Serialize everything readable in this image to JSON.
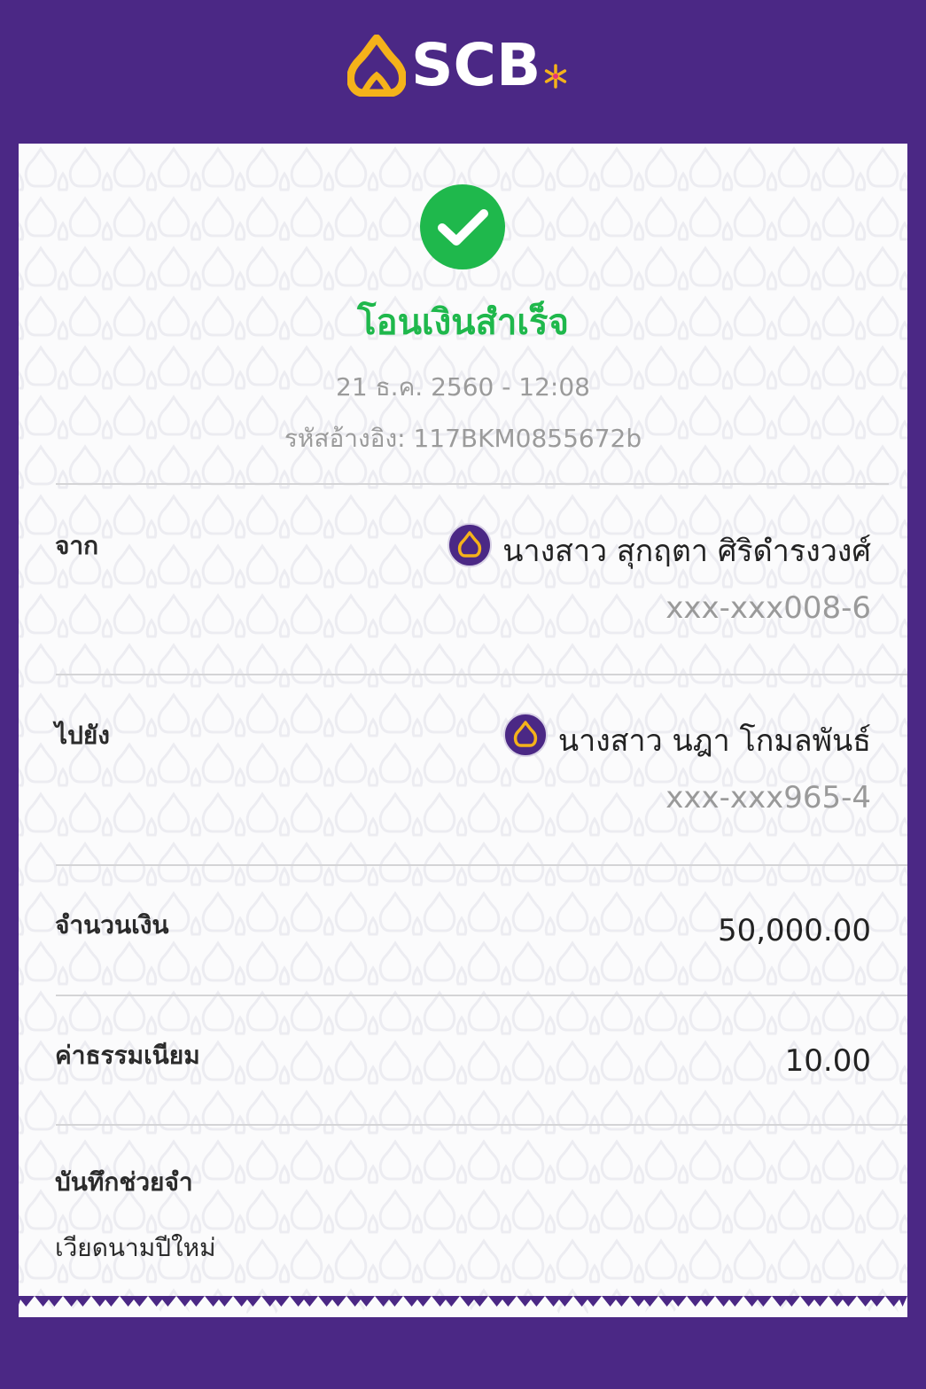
{
  "header": {
    "brand": "SCB",
    "colors": {
      "background": "#4b2885",
      "logo_gold": "#f5b21a",
      "star": "#f5b21a"
    }
  },
  "status": {
    "icon": "check-circle-icon",
    "title": "โอนเงินสำเร็จ",
    "datetime": "21 ธ.ค. 2560 - 12:08",
    "ref_label": "รหัสอ้างอิง:",
    "ref_value": "117BKM0855672b",
    "color": "#1fb84c"
  },
  "from": {
    "label": "จาก",
    "name": "นางสาว สุกฤตา ศิริดำรงวงศ์",
    "account": "xxx-xxx008-6",
    "bank_icon": "scb-bank-icon"
  },
  "to": {
    "label": "ไปยัง",
    "name": "นางสาว นฎา โกมลพันธ์",
    "account": "xxx-xxx965-4",
    "bank_icon": "scb-bank-icon"
  },
  "amount": {
    "label": "จำนวนเงิน",
    "value": "50,000.00"
  },
  "fee": {
    "label": "ค่าธรรมเนียม",
    "value": "10.00"
  },
  "memo": {
    "label": "บันทึกช่วยจำ",
    "value": "เวียดนามปีใหม่"
  }
}
